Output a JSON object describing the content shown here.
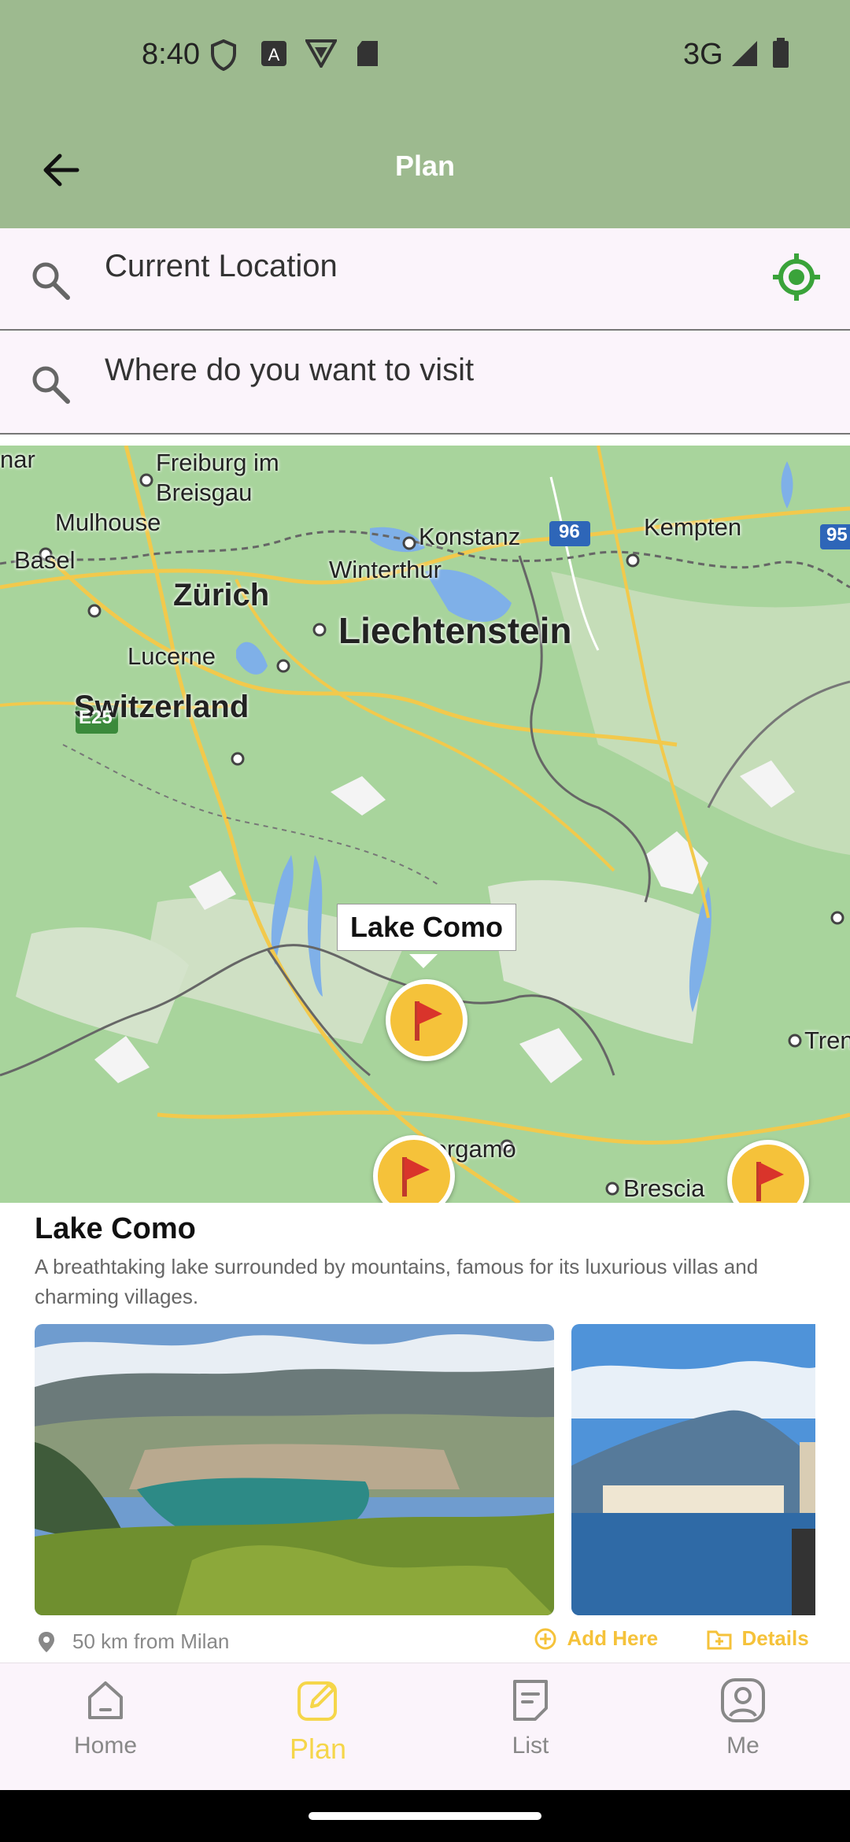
{
  "status": {
    "time": "8:40",
    "network": "3G"
  },
  "appbar": {
    "title": "Plan"
  },
  "search_from": {
    "value": "Current Location"
  },
  "search_to": {
    "placeholder": "Where do you want to visit"
  },
  "map": {
    "labels": {
      "freiburg1": "Freiburg im",
      "freiburg2": "Breisgau",
      "mulhouse": "Mulhouse",
      "basel": "Basel",
      "konstanz": "Konstanz",
      "kempten": "Kempten",
      "winterthur": "Winterthur",
      "zurich": "Zürich",
      "liechtenstein": "Liechtenstein",
      "lucerne": "Lucerne",
      "switzerland": "Switzerland",
      "bergamo": "Bergamo",
      "brescia": "Brescia",
      "trento": "Tren",
      "nar": "nar",
      "e25": "E25",
      "r96": "96",
      "r95": "95"
    },
    "callout": "Lake Como"
  },
  "card": {
    "title": "Lake Como",
    "description": "A breathtaking lake surrounded by mountains, famous for its luxurious villas and charming villages.",
    "distance": "50 km from Milan",
    "add_label": "Add Here",
    "details_label": "Details"
  },
  "nav": {
    "home": "Home",
    "plan": "Plan",
    "list": "List",
    "me": "Me"
  },
  "colors": {
    "header": "#9dba8f",
    "accent_yellow": "#f5c23a",
    "locate_green": "#3aa33a"
  }
}
